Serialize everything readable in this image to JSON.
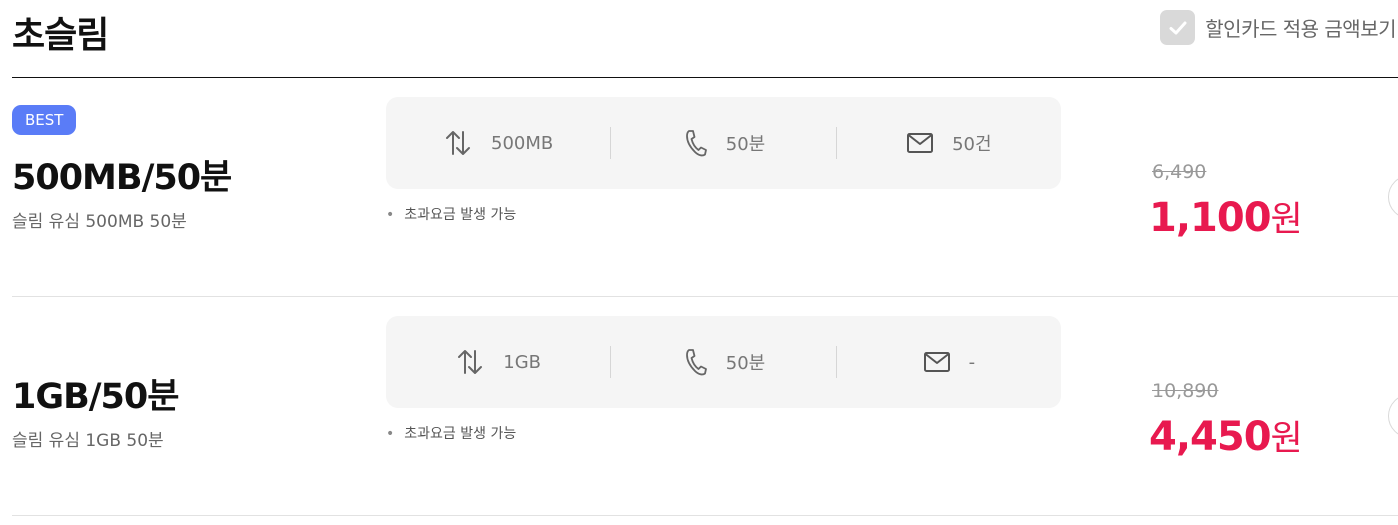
{
  "header": {
    "title": "초슬림",
    "discount_toggle_label": "할인카드 적용 금액보기",
    "discount_toggle_checked": true
  },
  "plans": [
    {
      "badge": "BEST",
      "name": "500MB/50분",
      "description": "슬림 유심 500MB 50분",
      "specs": {
        "data": "500MB",
        "voice": "50분",
        "sms": "50건"
      },
      "note": "초과요금 발생 가능",
      "original_price": "6,490",
      "sale_price": "1,100",
      "currency": "원"
    },
    {
      "name": "1GB/50분",
      "description": "슬림 유심 1GB 50분",
      "specs": {
        "data": "1GB",
        "voice": "50분",
        "sms": "-"
      },
      "note": "초과요금 발생 가능",
      "original_price": "10,890",
      "sale_price": "4,450",
      "currency": "원"
    }
  ],
  "icons": {
    "data": "arrows-up-down-icon",
    "voice": "phone-icon",
    "sms": "envelope-icon",
    "check": "check-icon"
  },
  "colors": {
    "accent": "#e8194f",
    "badge": "#5a7cf7",
    "spec_bg": "#f5f5f5"
  }
}
